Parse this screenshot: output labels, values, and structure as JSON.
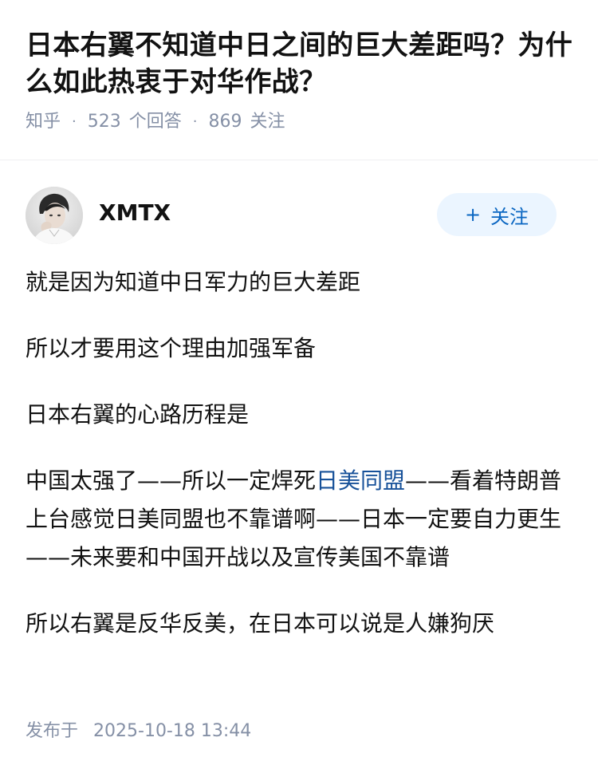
{
  "question": {
    "title": "日本右翼不知道中日之间的巨大差距吗？为什么如此热衷于对华作战？",
    "source": "知乎",
    "answer_count": "523",
    "answer_label": "个回答",
    "follower_count": "869",
    "follower_label": "关注",
    "separator": "·"
  },
  "author": {
    "name": "XMTX",
    "avatar_icon": "user-avatar-photo",
    "follow_plus": "+",
    "follow_label": "关注"
  },
  "answer": {
    "p1": "就是因为知道中日军力的巨大差距",
    "p2": "所以才要用这个理由加强军备",
    "p3": "日本右翼的心路历程是",
    "p4_before": "中国太强了——所以一定焊死",
    "p4_link": "日美同盟",
    "p4_after": "——看着特朗普上台感觉日美同盟也不靠谱啊——日本一定要自力更生——未来要和中国开战以及宣传美国不靠谱",
    "p5": "所以右翼是反华反美，在日本可以说是人嫌狗厌"
  },
  "publish": {
    "label": "发布于",
    "datetime": "2025-10-18 13:44"
  },
  "colors": {
    "link": "#175199",
    "meta": "#8590a6",
    "follow_bg": "#ebf5ff",
    "follow_text": "#0a66c2"
  }
}
